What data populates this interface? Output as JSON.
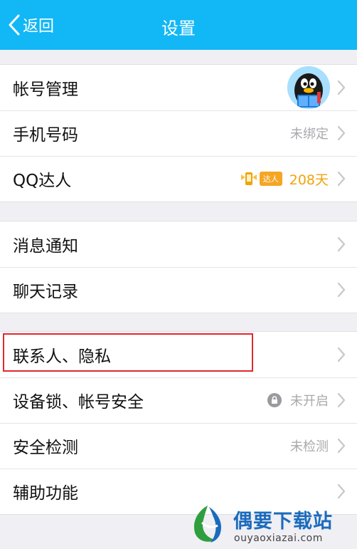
{
  "header": {
    "back_label": "返回",
    "title": "设置"
  },
  "groups": [
    {
      "rows": [
        {
          "label": "帐号管理"
        },
        {
          "label": "手机号码",
          "value": "未绑定"
        },
        {
          "label": "QQ达人",
          "badge": "达人",
          "value": "208天"
        }
      ]
    },
    {
      "rows": [
        {
          "label": "消息通知"
        },
        {
          "label": "聊天记录"
        }
      ]
    },
    {
      "rows": [
        {
          "label": "联系人、隐私"
        },
        {
          "label": "设备锁、帐号安全",
          "value": "未开启"
        },
        {
          "label": "安全检测",
          "value": "未检测"
        },
        {
          "label": "辅助功能"
        }
      ]
    }
  ],
  "watermark": {
    "brand": "偶要下载站",
    "url": "ouyaoxiazai.com"
  },
  "colors": {
    "navbar": "#12b7f5",
    "highlight": "#e0282e",
    "daren": "#f0a30a"
  },
  "icons": [
    "back-chevron-icon",
    "qq-penguin-avatar",
    "chevron-right-icon",
    "qq-daren-icon",
    "lock-icon"
  ]
}
